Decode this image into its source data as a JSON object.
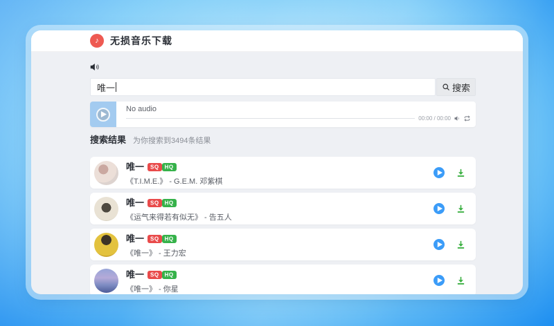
{
  "header": {
    "title": "无损音乐下载"
  },
  "search": {
    "query": "唯一",
    "button_label": "搜索"
  },
  "player": {
    "status": "No audio",
    "time": "00:00 / 00:00"
  },
  "results": {
    "heading": "搜索结果",
    "summary": "为你搜索到3494条结果"
  },
  "songs": [
    {
      "title": "唯一",
      "badges": [
        "SQ",
        "HQ"
      ],
      "subtitle": "《T.I.M.E.》 - G.E.M. 邓紫棋"
    },
    {
      "title": "唯一",
      "badges": [
        "SQ",
        "HQ"
      ],
      "subtitle": "《运气来得若有似无》 - 告五人"
    },
    {
      "title": "唯一",
      "badges": [
        "SQ",
        "HQ"
      ],
      "subtitle": "《唯一》 - 王力宏"
    },
    {
      "title": "唯一",
      "badges": [
        "SQ",
        "HQ"
      ],
      "subtitle": "《唯一》 - 你星"
    }
  ],
  "icons": {
    "logo": "music-note",
    "header_volume": "speaker-icon",
    "search": "magnifier-icon",
    "player_play": "play-icon",
    "player_volume": "speaker-icon",
    "player_loop": "repeat-icon",
    "row_play": "play-icon",
    "row_download": "download-icon"
  },
  "colors": {
    "logo_red": "#ee5a52",
    "badge_sq": "#e94b4b",
    "badge_hq": "#36b24a",
    "accent_blue": "#3b9cf8",
    "download_green": "#3cb043",
    "body_bg": "#eef0f4"
  }
}
